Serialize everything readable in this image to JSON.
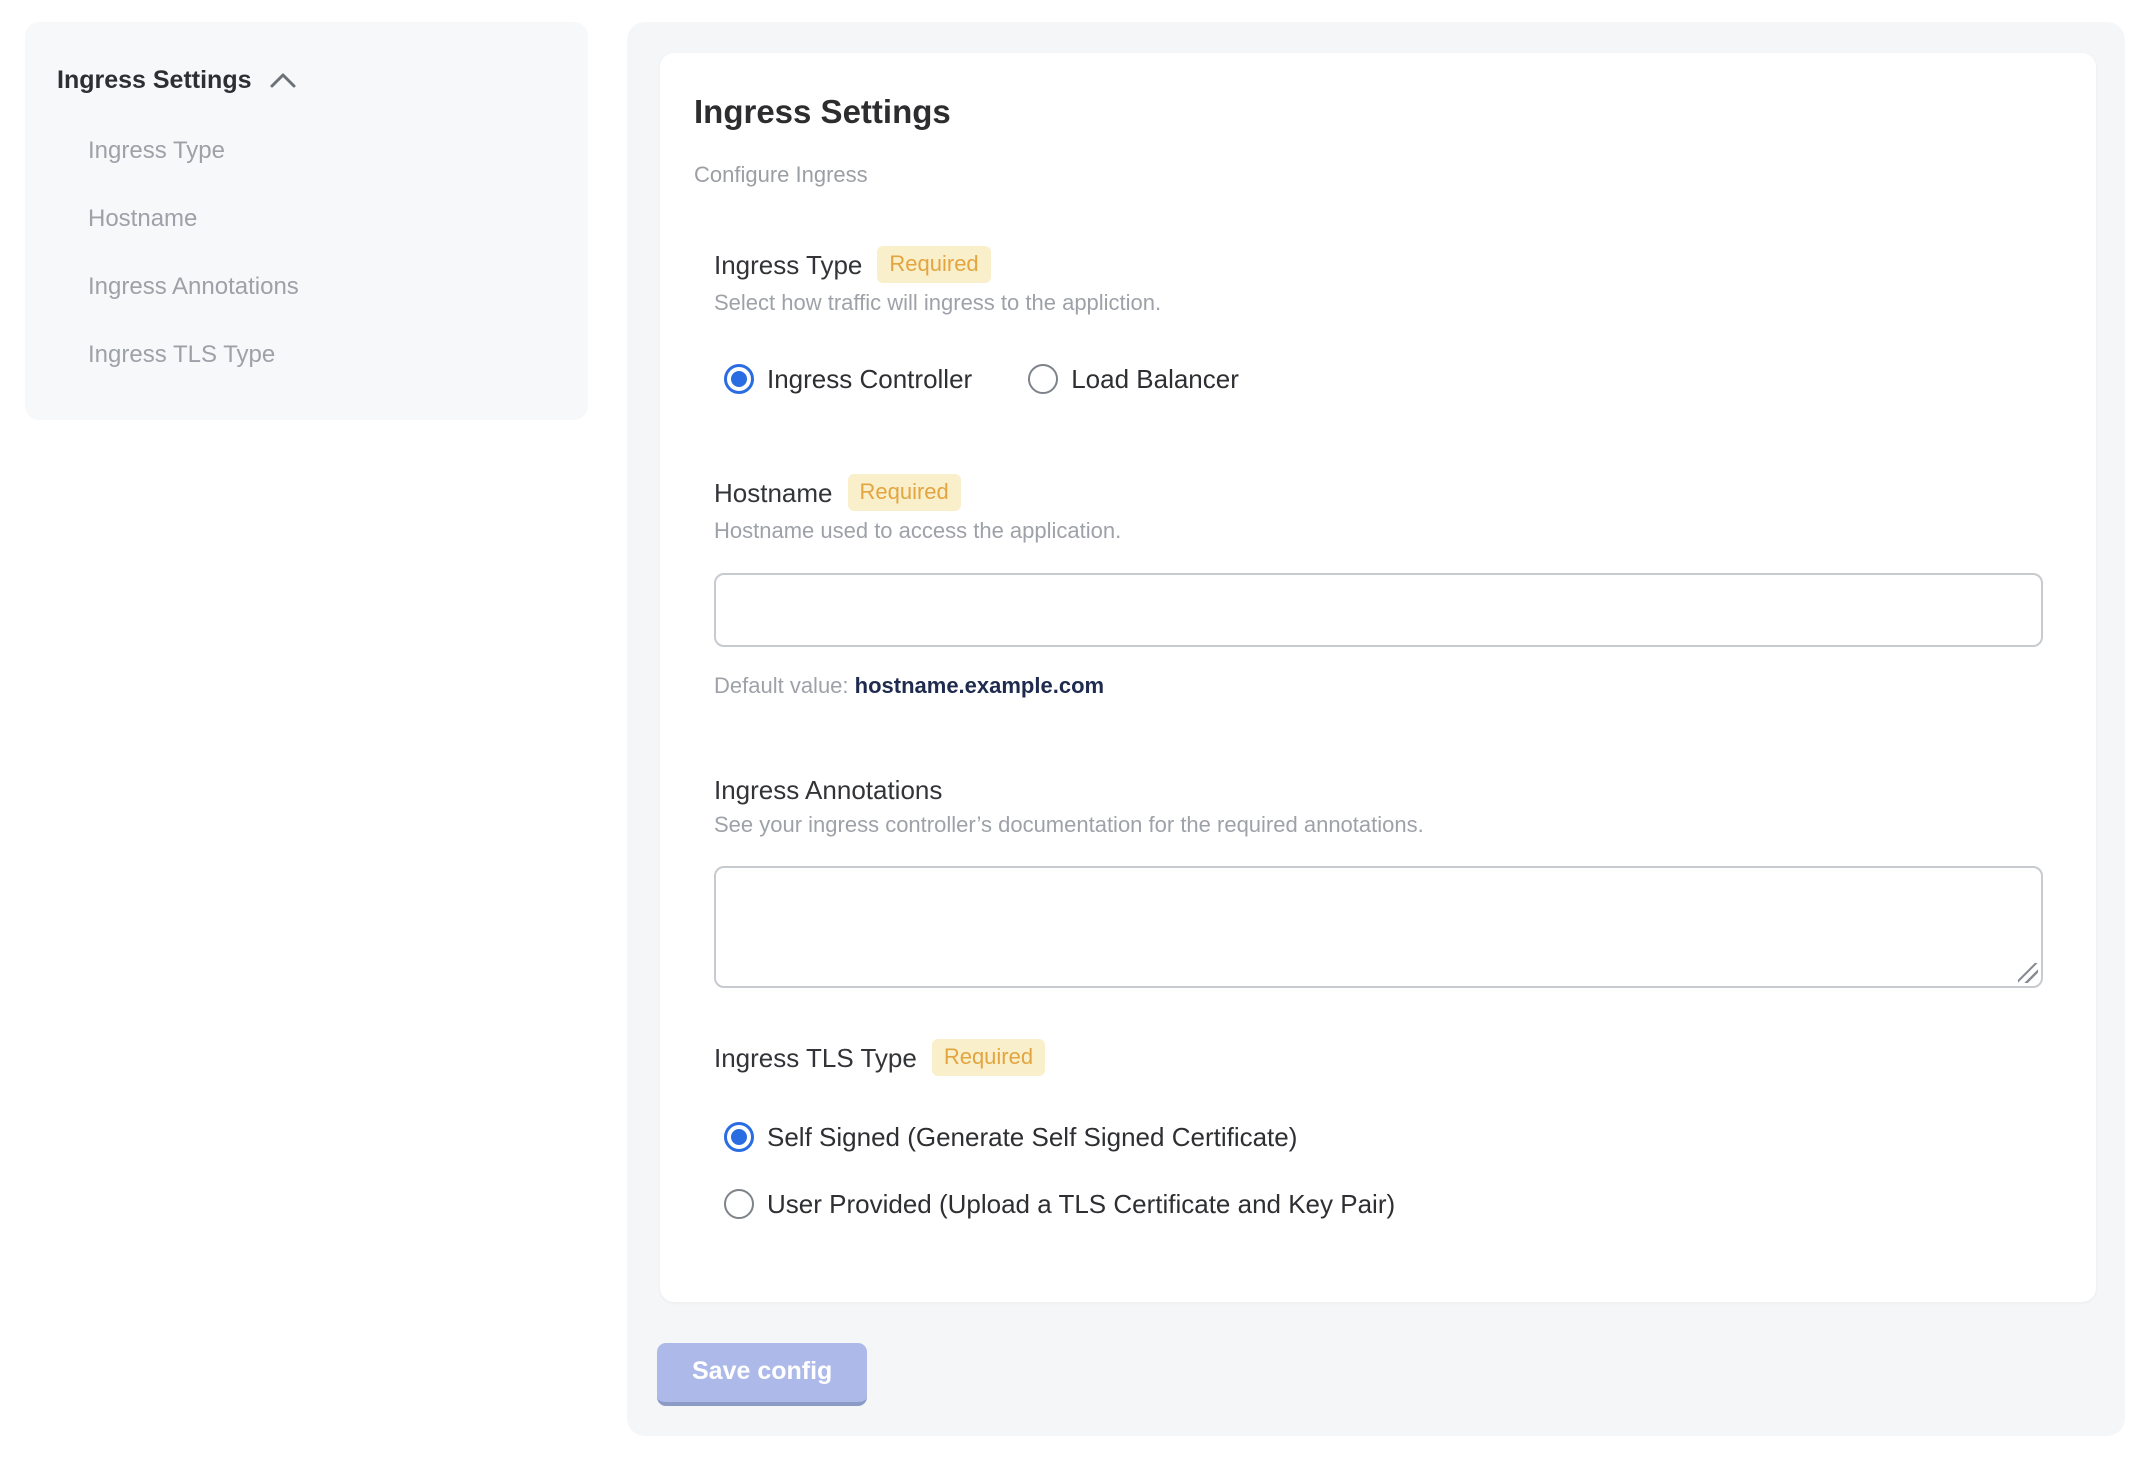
{
  "sidebar": {
    "header": "Ingress Settings",
    "collapse_icon": "chevron-up-icon",
    "items": [
      {
        "label": "Ingress Type"
      },
      {
        "label": "Hostname"
      },
      {
        "label": "Ingress Annotations"
      },
      {
        "label": "Ingress TLS Type"
      }
    ]
  },
  "form": {
    "title": "Ingress Settings",
    "subtitle": "Configure Ingress",
    "fields": {
      "ingress_type": {
        "label": "Ingress Type",
        "required_badge": "Required",
        "description": "Select how traffic will ingress to the appliction.",
        "options": [
          {
            "label": "Ingress Controller",
            "selected": true
          },
          {
            "label": "Load Balancer",
            "selected": false
          }
        ]
      },
      "hostname": {
        "label": "Hostname",
        "required_badge": "Required",
        "description": "Hostname used to access the application.",
        "value": "",
        "default_prefix": "Default value: ",
        "default_value": "hostname.example.com"
      },
      "annotations": {
        "label": "Ingress Annotations",
        "description": "See your ingress controller’s documentation for the required annotations.",
        "value": ""
      },
      "tls_type": {
        "label": "Ingress TLS Type",
        "required_badge": "Required",
        "options": [
          {
            "label": "Self Signed (Generate Self Signed Certificate)",
            "selected": true
          },
          {
            "label": "User Provided (Upload a TLS Certificate and Key Pair)",
            "selected": false
          }
        ]
      }
    },
    "save_button_label": "Save config"
  },
  "colors": {
    "accent_blue": "#2a6ce2",
    "badge_background": "#faefcb",
    "badge_text": "#e2a53f",
    "save_button_background": "#adbae9",
    "panel_background": "#f5f6f8",
    "sidebar_background": "#f7f8f9",
    "default_value_text": "#1f2b4e"
  }
}
